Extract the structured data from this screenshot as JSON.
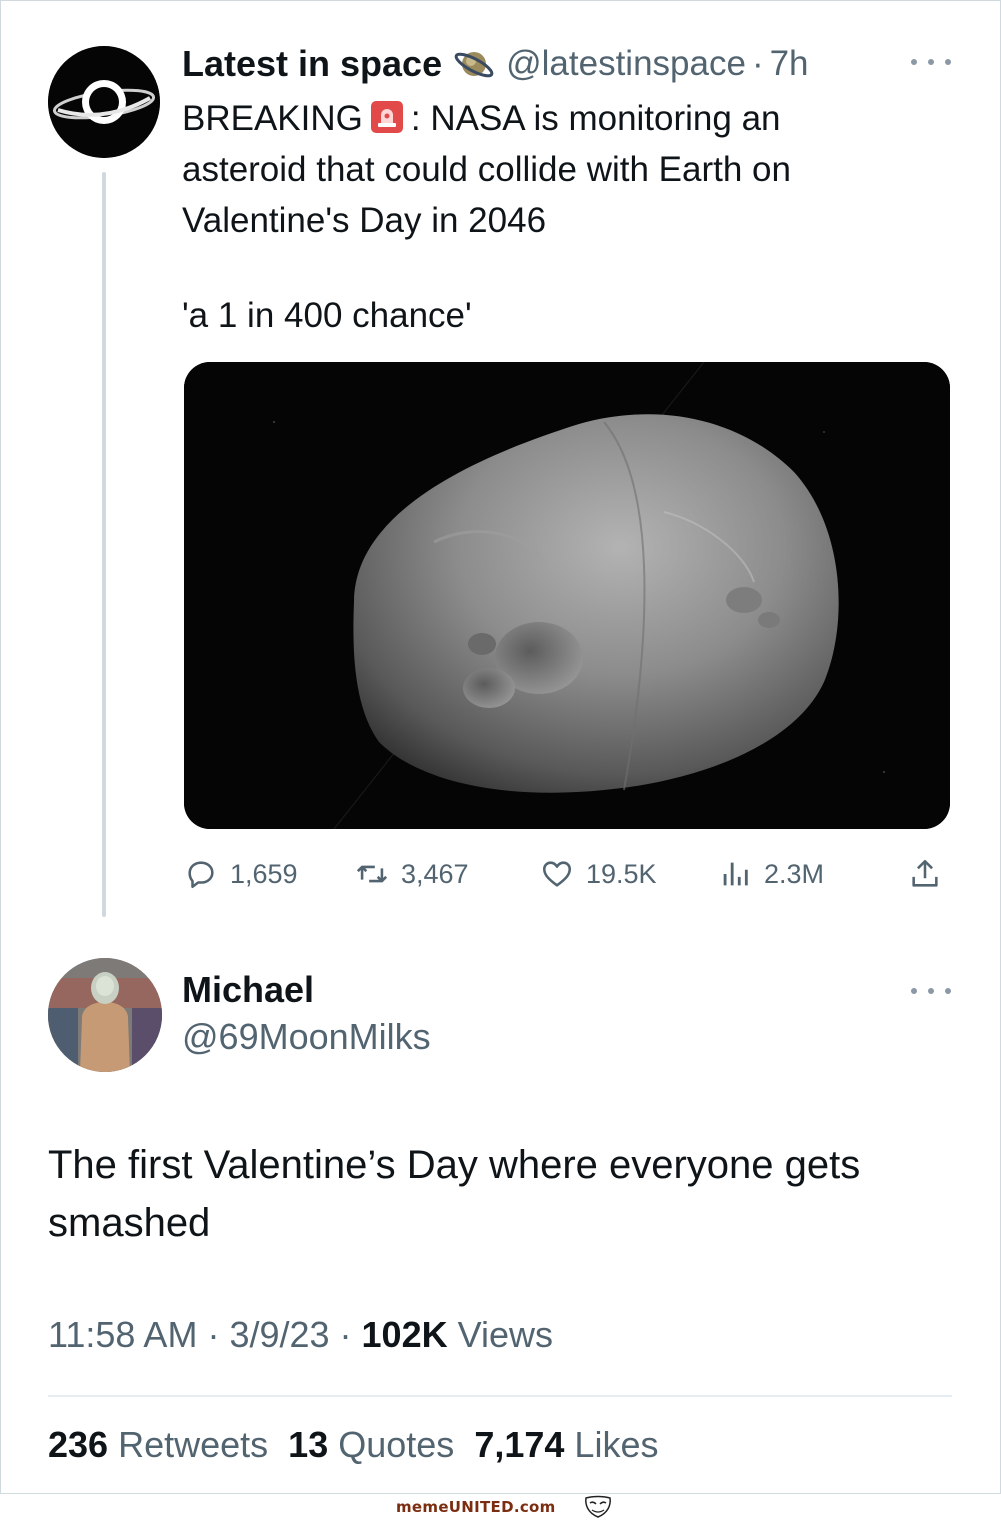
{
  "tweet": {
    "author_name": "Latest in space",
    "handle": "@latestinspace",
    "separator": "·",
    "time": "7h",
    "text_lines": [
      [
        "BREAKING",
        ": NASA is monitoring an"
      ],
      "asteroid that could collide with Earth on",
      "Valentine's Day in 2046"
    ],
    "quote": "'a 1 in 400 chance'",
    "stats": {
      "replies": "1,659",
      "retweets": "3,467",
      "likes": "19.5K",
      "views": "2.3M"
    },
    "icons": [
      "planet-logo-icon",
      "verified-planet-icon",
      "siren-icon",
      "reply-icon",
      "retweet-icon",
      "like-icon",
      "views-icon",
      "share-icon",
      "more-icon"
    ]
  },
  "reply": {
    "author_name": "Michael",
    "handle": "@69MoonMilks",
    "text_lines": [
      "The first Valentine’s Day where everyone gets",
      "smashed"
    ],
    "time": "11:58 AM",
    "date": "3/9/23",
    "views_count": "102K",
    "views_label": "Views",
    "retweets_count": "236",
    "retweets_label": "Retweets",
    "quotes_count": "13",
    "quotes_label": "Quotes",
    "likes_count": "7,174",
    "likes_label": "Likes"
  },
  "watermark": "memeUNITED.com",
  "colors": {
    "text": "#0f1419",
    "secondary": "#536471",
    "border": "#cfd9de",
    "watermark": "#7a2d10"
  }
}
